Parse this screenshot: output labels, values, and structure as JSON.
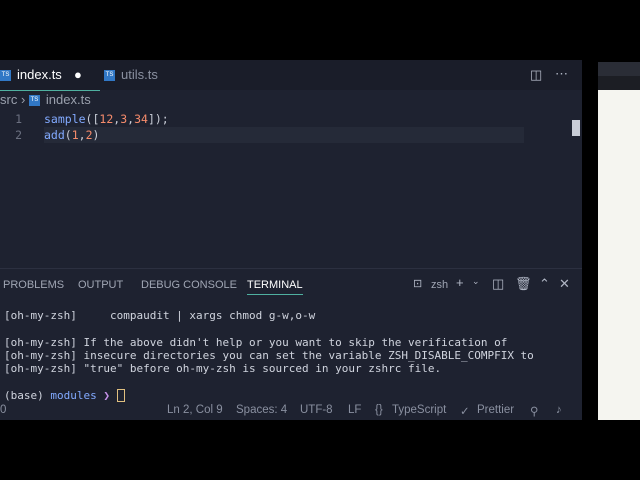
{
  "tabs": [
    {
      "label": "index.ts",
      "modified": true
    },
    {
      "label": "utils.ts"
    }
  ],
  "breadcrumb": {
    "folder": "src",
    "file": "index.ts"
  },
  "code": [
    {
      "n": "1",
      "fn": "sample",
      "args": "([",
      "a1": "12",
      "a2": "3",
      "a3": "34",
      "end": "]);"
    },
    {
      "n": "2",
      "fn": "add",
      "a1": "1",
      "a2": "2"
    }
  ],
  "panel_tabs": [
    "PROBLEMS",
    "OUTPUT",
    "DEBUG CONSOLE",
    "TERMINAL"
  ],
  "shell": "zsh",
  "terminal": [
    "[oh-my-zsh]     compaudit | xargs chmod g-w,o-w",
    "",
    "[oh-my-zsh] If the above didn't help or you want to skip the verification of",
    "[oh-my-zsh] insecure directories you can set the variable ZSH_DISABLE_COMPFIX to",
    "[oh-my-zsh] \"true\" before oh-my-zsh is sourced in your zshrc file."
  ],
  "prompt": {
    "env": "(base)",
    "dir": "modules",
    "arrow": "❯"
  },
  "status": {
    "left": "0",
    "position": "Ln 2, Col 9",
    "spaces": "Spaces: 4",
    "encoding": "UTF-8",
    "eol": "LF",
    "language": "TypeScript",
    "formatter": "Prettier"
  }
}
